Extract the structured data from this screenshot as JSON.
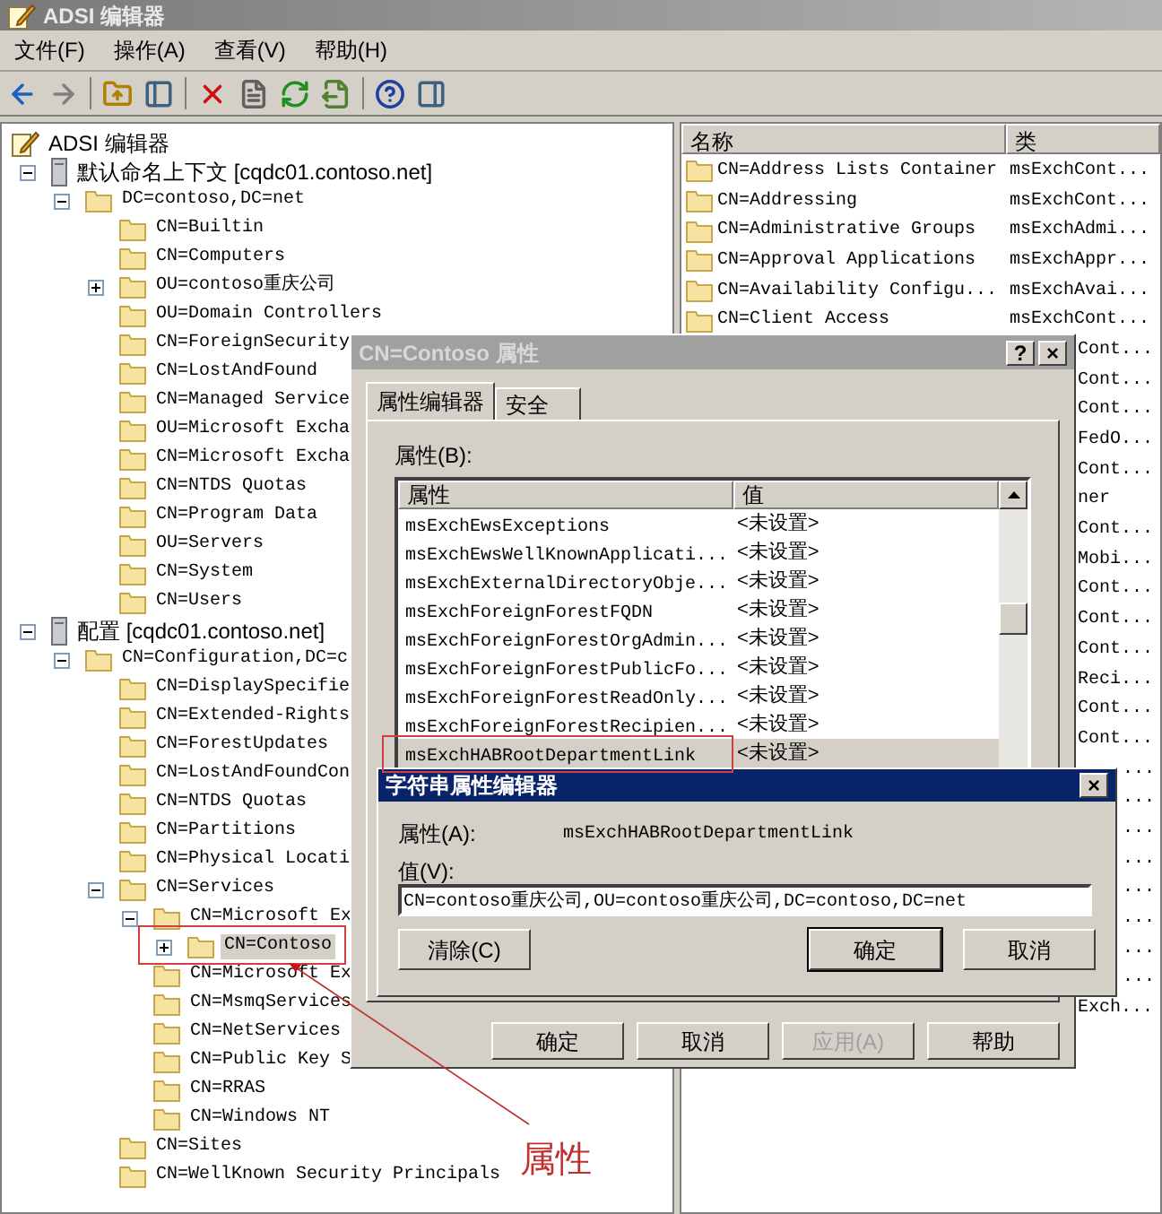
{
  "window": {
    "title": "ADSI 编辑器"
  },
  "menu": [
    "文件(F)",
    "操作(A)",
    "查看(V)",
    "帮助(H)"
  ],
  "tree": [
    {
      "label": "ADSI 编辑器",
      "kind": "root",
      "selected": false,
      "children": [
        {
          "label": "默认命名上下文 [cqdc01.contoso.net]",
          "kind": "server",
          "expanded": true,
          "selected": false,
          "children": [
            {
              "label": "DC=contoso,DC=net",
              "kind": "folder",
              "expanded": true,
              "selected": false,
              "children": [
                {
                  "label": "CN=Builtin",
                  "kind": "folder",
                  "selected": false
                },
                {
                  "label": "CN=Computers",
                  "kind": "folder",
                  "selected": false
                },
                {
                  "label": "OU=contoso重庆公司",
                  "kind": "folder",
                  "expanded": false,
                  "selected": false
                },
                {
                  "label": "OU=Domain Controllers",
                  "kind": "folder",
                  "selected": false
                },
                {
                  "label": "CN=ForeignSecurity",
                  "kind": "folder",
                  "selected": false
                },
                {
                  "label": "CN=LostAndFound",
                  "kind": "folder",
                  "selected": false
                },
                {
                  "label": "CN=Managed Service",
                  "kind": "folder",
                  "selected": false
                },
                {
                  "label": "OU=Microsoft Excha",
                  "kind": "folder",
                  "selected": false
                },
                {
                  "label": "CN=Microsoft Excha",
                  "kind": "folder",
                  "selected": false
                },
                {
                  "label": "CN=NTDS Quotas",
                  "kind": "folder",
                  "selected": false
                },
                {
                  "label": "CN=Program Data",
                  "kind": "folder",
                  "selected": false
                },
                {
                  "label": "OU=Servers",
                  "kind": "folder",
                  "selected": false
                },
                {
                  "label": "CN=System",
                  "kind": "folder",
                  "selected": false
                },
                {
                  "label": "CN=Users",
                  "kind": "folder",
                  "selected": false
                }
              ]
            }
          ]
        },
        {
          "label": "配置 [cqdc01.contoso.net]",
          "kind": "server",
          "expanded": true,
          "selected": false,
          "children": [
            {
              "label": "CN=Configuration,DC=c",
              "kind": "folder",
              "expanded": true,
              "selected": false,
              "children": [
                {
                  "label": "CN=DisplaySpecifie",
                  "kind": "folder",
                  "selected": false
                },
                {
                  "label": "CN=Extended-Rights",
                  "kind": "folder",
                  "selected": false
                },
                {
                  "label": "CN=ForestUpdates",
                  "kind": "folder",
                  "selected": false
                },
                {
                  "label": "CN=LostAndFoundCon",
                  "kind": "folder",
                  "selected": false
                },
                {
                  "label": "CN=NTDS Quotas",
                  "kind": "folder",
                  "selected": false
                },
                {
                  "label": "CN=Partitions",
                  "kind": "folder",
                  "selected": false
                },
                {
                  "label": "CN=Physical Locati",
                  "kind": "folder",
                  "selected": false
                },
                {
                  "label": "CN=Services",
                  "kind": "folder",
                  "expanded": true,
                  "selected": false,
                  "children": [
                    {
                      "label": "CN=Microsoft Ex",
                      "kind": "folder",
                      "expanded": true,
                      "selected": false,
                      "children": [
                        {
                          "label": "CN=Contoso",
                          "kind": "folder",
                          "expanded": false,
                          "selected": true
                        }
                      ]
                    },
                    {
                      "label": "CN=Microsoft Ex",
                      "kind": "folder",
                      "selected": false
                    },
                    {
                      "label": "CN=MsmqServices",
                      "kind": "folder",
                      "selected": false
                    },
                    {
                      "label": "CN=NetServices",
                      "kind": "folder",
                      "selected": false
                    },
                    {
                      "label": "CN=Public Key S",
                      "kind": "folder",
                      "selected": false
                    },
                    {
                      "label": "CN=RRAS",
                      "kind": "folder",
                      "selected": false
                    },
                    {
                      "label": "CN=Windows NT",
                      "kind": "folder",
                      "selected": false
                    }
                  ]
                },
                {
                  "label": "CN=Sites",
                  "kind": "folder",
                  "selected": false
                },
                {
                  "label": "CN=WellKnown Security Principals",
                  "kind": "folder",
                  "selected": false
                }
              ]
            }
          ]
        }
      ]
    }
  ],
  "list": {
    "columns": [
      "名称",
      "类"
    ],
    "rows": [
      {
        "kind": "full",
        "name": "CN=Address Lists Container",
        "class": "msExchCont..."
      },
      {
        "kind": "full",
        "name": "CN=Addressing",
        "class": "msExchCont..."
      },
      {
        "kind": "full",
        "name": "CN=Administrative Groups",
        "class": "msExchAdmi..."
      },
      {
        "kind": "full",
        "name": "CN=Approval Applications",
        "class": "msExchAppr..."
      },
      {
        "kind": "full",
        "name": "CN=Availability Configu...",
        "class": "msExchAvai..."
      },
      {
        "kind": "full",
        "name": "CN=Client Access",
        "class": "msExchCont..."
      },
      {
        "kind": "tail",
        "class": "Cont..."
      },
      {
        "kind": "tail",
        "class": "Cont..."
      },
      {
        "kind": "tail",
        "class": "Cont..."
      },
      {
        "kind": "tail",
        "class": "FedO..."
      },
      {
        "kind": "tail",
        "class": "Cont..."
      },
      {
        "kind": "tail",
        "class": "ner"
      },
      {
        "kind": "tail",
        "class": "Cont..."
      },
      {
        "kind": "tail",
        "class": "Mobi..."
      },
      {
        "kind": "tail",
        "class": "Cont..."
      },
      {
        "kind": "tail",
        "class": "Cont..."
      },
      {
        "kind": "tail",
        "class": "Cont..."
      },
      {
        "kind": "tail",
        "class": "Reci..."
      },
      {
        "kind": "tail",
        "class": "Cont..."
      },
      {
        "kind": "tail",
        "class": "Cont..."
      },
      {
        "kind": "dots",
        "class": "..."
      },
      {
        "kind": "dots",
        "class": "..."
      },
      {
        "kind": "dots",
        "class": "..."
      },
      {
        "kind": "dots",
        "class": "..."
      },
      {
        "kind": "dots",
        "class": "..."
      },
      {
        "kind": "dots",
        "class": "..."
      },
      {
        "kind": "dots",
        "class": "..."
      },
      {
        "kind": "dots",
        "class": "..."
      },
      {
        "kind": "tail",
        "class": "Exch..."
      }
    ]
  },
  "properties_dialog": {
    "title": "CN=Contoso 属性",
    "title_buttons": [
      "?",
      "×"
    ],
    "tabs": [
      {
        "label": "属性编辑器",
        "selected": true
      },
      {
        "label": "安全",
        "selected": false
      }
    ],
    "list_label": "属性(B):",
    "columns": [
      "属性",
      "值"
    ],
    "rows": [
      {
        "attribute": "msExchEwsExceptions",
        "value": "<未设置>",
        "selected": false
      },
      {
        "attribute": "msExchEwsWellKnownApplicati...",
        "value": "<未设置>",
        "selected": false
      },
      {
        "attribute": "msExchExternalDirectoryObje...",
        "value": "<未设置>",
        "selected": false
      },
      {
        "attribute": "msExchForeignForestFQDN",
        "value": "<未设置>",
        "selected": false
      },
      {
        "attribute": "msExchForeignForestOrgAdmin...",
        "value": "<未设置>",
        "selected": false
      },
      {
        "attribute": "msExchForeignForestPublicFo...",
        "value": "<未设置>",
        "selected": false
      },
      {
        "attribute": "msExchForeignForestReadOnly...",
        "value": "<未设置>",
        "selected": false
      },
      {
        "attribute": "msExchForeignForestRecipien...",
        "value": "<未设置>",
        "selected": false
      },
      {
        "attribute": "msExchHABRootDepartmentLink",
        "value": "<未设置>",
        "selected": true
      }
    ],
    "buttons": [
      {
        "label": "确定",
        "disabled": false
      },
      {
        "label": "取消",
        "disabled": false
      },
      {
        "label": "应用(A)",
        "disabled": true
      },
      {
        "label": "帮助",
        "disabled": false
      }
    ]
  },
  "string_dialog": {
    "title": "字符串属性编辑器",
    "close": "×",
    "attribute_label": "属性(A):",
    "attribute": "msExchHABRootDepartmentLink",
    "value_label": "值(V):",
    "value": "CN=contoso重庆公司,OU=contoso重庆公司,DC=contoso,DC=net",
    "buttons": [
      {
        "label": "清除(C)",
        "default": false
      },
      {
        "label": "确定",
        "default": true
      },
      {
        "label": "取消",
        "default": false
      }
    ]
  },
  "annotation": {
    "label": "属性"
  }
}
